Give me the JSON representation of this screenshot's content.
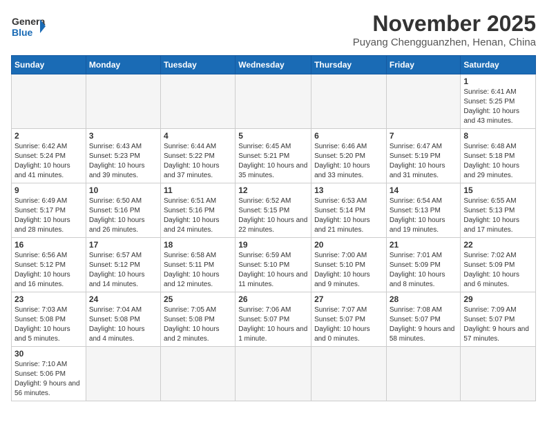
{
  "header": {
    "logo_general": "General",
    "logo_blue": "Blue",
    "month_year": "November 2025",
    "location": "Puyang Chengguanzhen, Henan, China"
  },
  "days_of_week": [
    "Sunday",
    "Monday",
    "Tuesday",
    "Wednesday",
    "Thursday",
    "Friday",
    "Saturday"
  ],
  "weeks": [
    [
      {
        "day": "",
        "info": ""
      },
      {
        "day": "",
        "info": ""
      },
      {
        "day": "",
        "info": ""
      },
      {
        "day": "",
        "info": ""
      },
      {
        "day": "",
        "info": ""
      },
      {
        "day": "",
        "info": ""
      },
      {
        "day": "1",
        "info": "Sunrise: 6:41 AM\nSunset: 5:25 PM\nDaylight: 10 hours and 43 minutes."
      }
    ],
    [
      {
        "day": "2",
        "info": "Sunrise: 6:42 AM\nSunset: 5:24 PM\nDaylight: 10 hours and 41 minutes."
      },
      {
        "day": "3",
        "info": "Sunrise: 6:43 AM\nSunset: 5:23 PM\nDaylight: 10 hours and 39 minutes."
      },
      {
        "day": "4",
        "info": "Sunrise: 6:44 AM\nSunset: 5:22 PM\nDaylight: 10 hours and 37 minutes."
      },
      {
        "day": "5",
        "info": "Sunrise: 6:45 AM\nSunset: 5:21 PM\nDaylight: 10 hours and 35 minutes."
      },
      {
        "day": "6",
        "info": "Sunrise: 6:46 AM\nSunset: 5:20 PM\nDaylight: 10 hours and 33 minutes."
      },
      {
        "day": "7",
        "info": "Sunrise: 6:47 AM\nSunset: 5:19 PM\nDaylight: 10 hours and 31 minutes."
      },
      {
        "day": "8",
        "info": "Sunrise: 6:48 AM\nSunset: 5:18 PM\nDaylight: 10 hours and 29 minutes."
      }
    ],
    [
      {
        "day": "9",
        "info": "Sunrise: 6:49 AM\nSunset: 5:17 PM\nDaylight: 10 hours and 28 minutes."
      },
      {
        "day": "10",
        "info": "Sunrise: 6:50 AM\nSunset: 5:16 PM\nDaylight: 10 hours and 26 minutes."
      },
      {
        "day": "11",
        "info": "Sunrise: 6:51 AM\nSunset: 5:16 PM\nDaylight: 10 hours and 24 minutes."
      },
      {
        "day": "12",
        "info": "Sunrise: 6:52 AM\nSunset: 5:15 PM\nDaylight: 10 hours and 22 minutes."
      },
      {
        "day": "13",
        "info": "Sunrise: 6:53 AM\nSunset: 5:14 PM\nDaylight: 10 hours and 21 minutes."
      },
      {
        "day": "14",
        "info": "Sunrise: 6:54 AM\nSunset: 5:13 PM\nDaylight: 10 hours and 19 minutes."
      },
      {
        "day": "15",
        "info": "Sunrise: 6:55 AM\nSunset: 5:13 PM\nDaylight: 10 hours and 17 minutes."
      }
    ],
    [
      {
        "day": "16",
        "info": "Sunrise: 6:56 AM\nSunset: 5:12 PM\nDaylight: 10 hours and 16 minutes."
      },
      {
        "day": "17",
        "info": "Sunrise: 6:57 AM\nSunset: 5:12 PM\nDaylight: 10 hours and 14 minutes."
      },
      {
        "day": "18",
        "info": "Sunrise: 6:58 AM\nSunset: 5:11 PM\nDaylight: 10 hours and 12 minutes."
      },
      {
        "day": "19",
        "info": "Sunrise: 6:59 AM\nSunset: 5:10 PM\nDaylight: 10 hours and 11 minutes."
      },
      {
        "day": "20",
        "info": "Sunrise: 7:00 AM\nSunset: 5:10 PM\nDaylight: 10 hours and 9 minutes."
      },
      {
        "day": "21",
        "info": "Sunrise: 7:01 AM\nSunset: 5:09 PM\nDaylight: 10 hours and 8 minutes."
      },
      {
        "day": "22",
        "info": "Sunrise: 7:02 AM\nSunset: 5:09 PM\nDaylight: 10 hours and 6 minutes."
      }
    ],
    [
      {
        "day": "23",
        "info": "Sunrise: 7:03 AM\nSunset: 5:08 PM\nDaylight: 10 hours and 5 minutes."
      },
      {
        "day": "24",
        "info": "Sunrise: 7:04 AM\nSunset: 5:08 PM\nDaylight: 10 hours and 4 minutes."
      },
      {
        "day": "25",
        "info": "Sunrise: 7:05 AM\nSunset: 5:08 PM\nDaylight: 10 hours and 2 minutes."
      },
      {
        "day": "26",
        "info": "Sunrise: 7:06 AM\nSunset: 5:07 PM\nDaylight: 10 hours and 1 minute."
      },
      {
        "day": "27",
        "info": "Sunrise: 7:07 AM\nSunset: 5:07 PM\nDaylight: 10 hours and 0 minutes."
      },
      {
        "day": "28",
        "info": "Sunrise: 7:08 AM\nSunset: 5:07 PM\nDaylight: 9 hours and 58 minutes."
      },
      {
        "day": "29",
        "info": "Sunrise: 7:09 AM\nSunset: 5:07 PM\nDaylight: 9 hours and 57 minutes."
      }
    ],
    [
      {
        "day": "30",
        "info": "Sunrise: 7:10 AM\nSunset: 5:06 PM\nDaylight: 9 hours and 56 minutes."
      },
      {
        "day": "",
        "info": ""
      },
      {
        "day": "",
        "info": ""
      },
      {
        "day": "",
        "info": ""
      },
      {
        "day": "",
        "info": ""
      },
      {
        "day": "",
        "info": ""
      },
      {
        "day": "",
        "info": ""
      }
    ]
  ]
}
